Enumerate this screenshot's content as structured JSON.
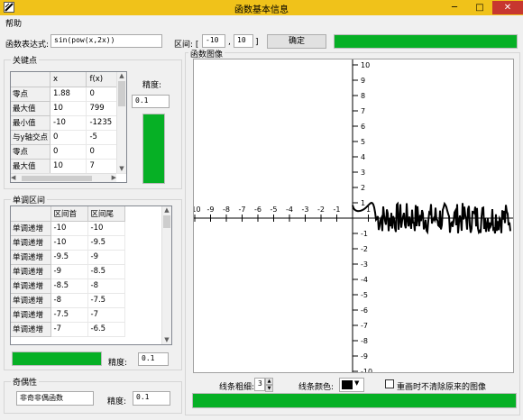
{
  "window": {
    "title": "函数基本信息",
    "minimize": "─",
    "maximize": "□",
    "close": "✕"
  },
  "menu": {
    "help": "帮助"
  },
  "expr": {
    "label": "函数表达式:",
    "value": "sin(pow(x,2x))"
  },
  "range": {
    "label": "区间: [",
    "from": "-10",
    "sep": ",",
    "to": "10",
    "close": "]"
  },
  "confirm_label": "确定",
  "progress": {
    "top": 1.0,
    "left": 1.0,
    "mono": 1.0,
    "bottom": 1.0
  },
  "key_points": {
    "legend": "关键点",
    "columns": [
      "x",
      "f(x)"
    ],
    "rows": [
      {
        "name": "零点",
        "x": "1.88",
        "fx": "0"
      },
      {
        "name": "最大值",
        "x": "10",
        "fx": "799"
      },
      {
        "name": "最小值",
        "x": "-10",
        "fx": "-1235"
      },
      {
        "name": "与y轴交点",
        "x": "0",
        "fx": "-5"
      },
      {
        "name": "零点",
        "x": "0",
        "fx": "0"
      },
      {
        "name": "最大值",
        "x": "10",
        "fx": "7"
      }
    ],
    "precision_label": "精度:",
    "precision": "0.1"
  },
  "mono": {
    "legend": "单调区间",
    "columns": [
      "区间首",
      "区间尾"
    ],
    "rows": [
      {
        "name": "单调递增",
        "start": "-10",
        "end": "-10"
      },
      {
        "name": "单调递增",
        "start": "-10",
        "end": "-9.5"
      },
      {
        "name": "单调递增",
        "start": "-9.5",
        "end": "-9"
      },
      {
        "name": "单调递增",
        "start": "-9",
        "end": "-8.5"
      },
      {
        "name": "单调递增",
        "start": "-8.5",
        "end": "-8"
      },
      {
        "name": "单调递增",
        "start": "-8",
        "end": "-7.5"
      },
      {
        "name": "单调递增",
        "start": "-7.5",
        "end": "-7"
      },
      {
        "name": "单调递增",
        "start": "-7",
        "end": "-6.5"
      }
    ],
    "precision_label": "精度:",
    "precision": "0.1"
  },
  "parity": {
    "legend": "奇偶性",
    "value": "非奇非偶函数",
    "precision_label": "精度:",
    "precision": "0.1"
  },
  "graph": {
    "legend": "函数图像"
  },
  "chart_data": {
    "type": "line",
    "xlim": [
      -10,
      10
    ],
    "ylim": [
      -10,
      10
    ],
    "xticks": [
      "-10",
      "-9",
      "-8",
      "-7",
      "-6",
      "-5",
      "-4",
      "-3",
      "-2",
      "-1",
      "1"
    ],
    "yticks": [
      "10",
      "9",
      "8",
      "7",
      "6",
      "5",
      "4",
      "3",
      "2",
      "1",
      "-1",
      "-2",
      "-3",
      "-4",
      "-5",
      "-6",
      "-7",
      "-8",
      "-9",
      "-10"
    ],
    "grid": false,
    "series": [
      {
        "color": "#000000",
        "function": "sin(pow(x,2x))",
        "x_start": 0,
        "x_end": 10,
        "y_range": [
          -1,
          1
        ]
      }
    ]
  },
  "line_width": {
    "label": "线条粗细:",
    "value": "3",
    "up": "▲",
    "down": "▼"
  },
  "line_color": {
    "label": "线条颜色:",
    "color": "#000000",
    "arrow": "▼"
  },
  "keep_graph": {
    "label": "重画时不清除原来的图像",
    "checked": false
  }
}
